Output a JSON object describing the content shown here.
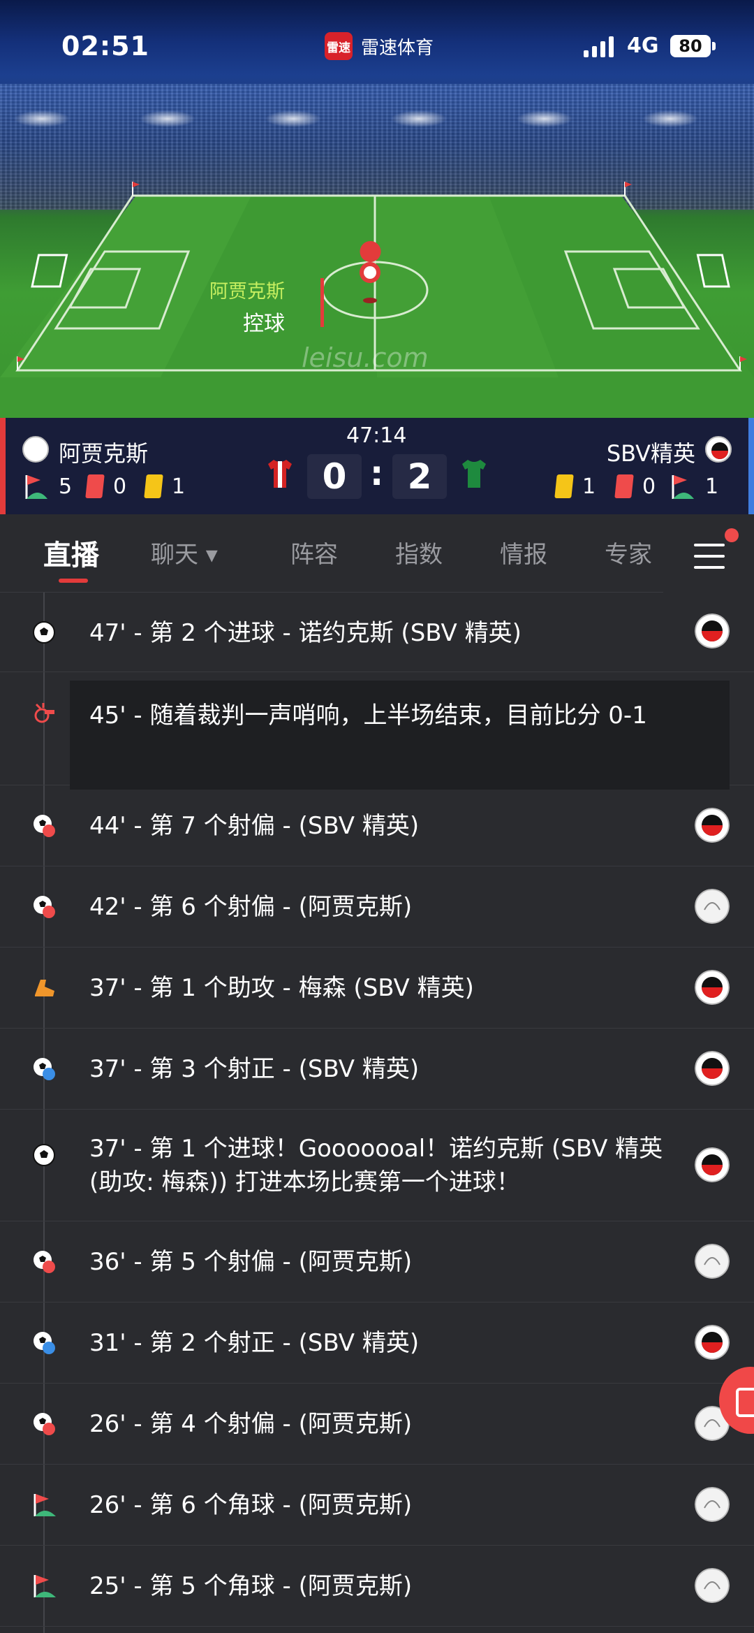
{
  "status_bar": {
    "time": "02:51",
    "network": "4G",
    "battery": "80"
  },
  "app": {
    "logo_text": "雷速",
    "name": "雷速体育"
  },
  "pitch": {
    "possession_team": "阿贾克斯",
    "possession_label": "控球",
    "watermark": "leisu.com"
  },
  "match": {
    "clock": "47:14",
    "home": {
      "name": "阿贾克斯",
      "score": "0",
      "corners": "5",
      "red": "0",
      "yellow": "1"
    },
    "away": {
      "name": "SBV精英",
      "score": "2",
      "yellow": "1",
      "red": "0",
      "corners": "1"
    },
    "colon": ":"
  },
  "tabs": [
    "直播",
    "聊天 ▾",
    "阵容",
    "指数",
    "情报",
    "专家"
  ],
  "events": [
    {
      "text": "47' - 第 2 个进球 - 诺约克斯 (SBV 精英)",
      "icon": "ball-icon",
      "team": "away"
    },
    {
      "text": "45' - 随着裁判一声哨响，上半场结束，目前比分 0-1",
      "icon": "whistle-icon",
      "team": "none"
    },
    {
      "text": "44' - 第 7 个射偏 - (SBV 精英)",
      "icon": "shot-off-icon",
      "team": "away"
    },
    {
      "text": "42' - 第 6 个射偏 - (阿贾克斯)",
      "icon": "shot-off-icon",
      "team": "home"
    },
    {
      "text": "37' - 第 1 个助攻 - 梅森 (SBV 精英)",
      "icon": "assist-boot-icon",
      "team": "away"
    },
    {
      "text": "37' - 第 3 个射正 - (SBV 精英)",
      "icon": "shot-on-icon",
      "team": "away"
    },
    {
      "text": "37' - 第 1 个进球！Gooooooal！诺约克斯 (SBV 精英 (助攻: 梅森)) 打进本场比赛第一个进球！",
      "icon": "ball-icon",
      "team": "away"
    },
    {
      "text": "36' - 第 5 个射偏 - (阿贾克斯)",
      "icon": "shot-off-icon",
      "team": "home"
    },
    {
      "text": "31' - 第 2 个射正 - (SBV 精英)",
      "icon": "shot-on-icon",
      "team": "away"
    },
    {
      "text": "26' - 第 4 个射偏 - (阿贾克斯)",
      "icon": "shot-off-icon",
      "team": "home"
    },
    {
      "text": "26' - 第 6 个角球 - (阿贾克斯)",
      "icon": "corner-flag-icon",
      "team": "home"
    },
    {
      "text": "25' - 第 5 个角球 - (阿贾克斯)",
      "icon": "corner-flag-icon",
      "team": "home"
    }
  ],
  "colors": {
    "accent_red": "#e33b3b",
    "away_blue": "#3f7de0",
    "possession_green": "#c6ef60",
    "score_bg": "#181d3a"
  }
}
